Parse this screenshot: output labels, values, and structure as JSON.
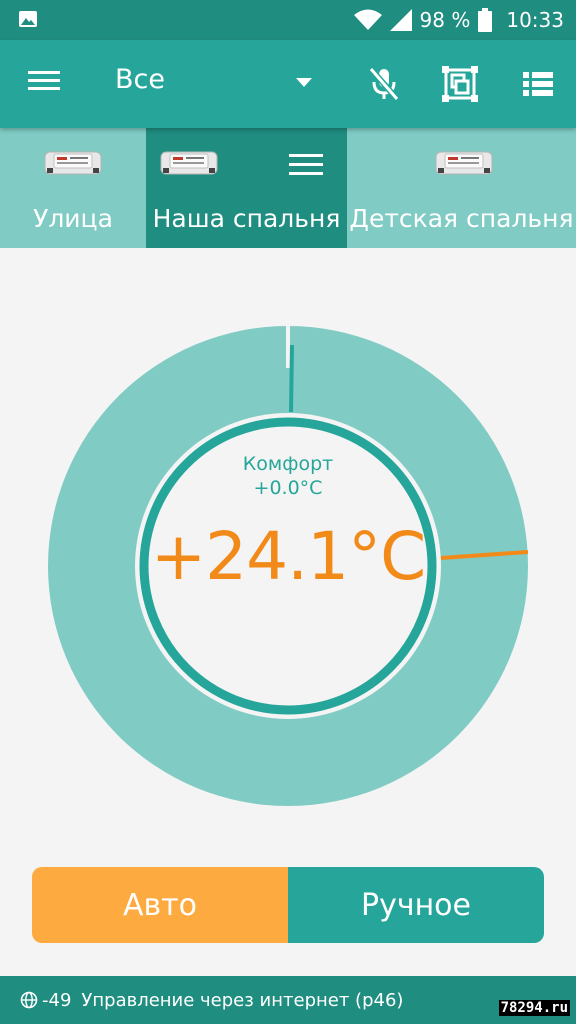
{
  "status_bar": {
    "battery": "98 %",
    "time": "10:33",
    "icons": [
      "image-icon",
      "wifi-icon",
      "cell-signal-icon",
      "battery-icon"
    ]
  },
  "toolbar": {
    "filter_label": "Все",
    "icons": [
      "menu-icon",
      "dropdown-arrow-icon",
      "mic-off-icon",
      "group-frame-icon",
      "list-icon"
    ]
  },
  "tabs": [
    {
      "label": "Улица",
      "icon": "relay-device-icon",
      "active": false
    },
    {
      "label": "Наша спальня",
      "icon": "relay-device-icon",
      "active": true
    },
    {
      "label": "Детская спальня",
      "icon": "relay-device-icon",
      "active": false
    }
  ],
  "thermostat": {
    "mode_name": "Комфорт",
    "offset": "+0.0°C",
    "temperature": "+24.1°C",
    "target_marker_color": "#f28a1a"
  },
  "mode_buttons": {
    "auto_label": "Авто",
    "manual_label": "Ручное"
  },
  "footer": {
    "signal": "-49",
    "connection": "Управление через интернет (р46)"
  },
  "watermark": "78294.ru",
  "colors": {
    "primary": "#26a69a",
    "primary_dark": "#1f8d80",
    "primary_light": "#80cbc4",
    "accent_orange": "#fdab40",
    "temp_orange": "#f28a1a",
    "background": "#f4f4f4"
  }
}
